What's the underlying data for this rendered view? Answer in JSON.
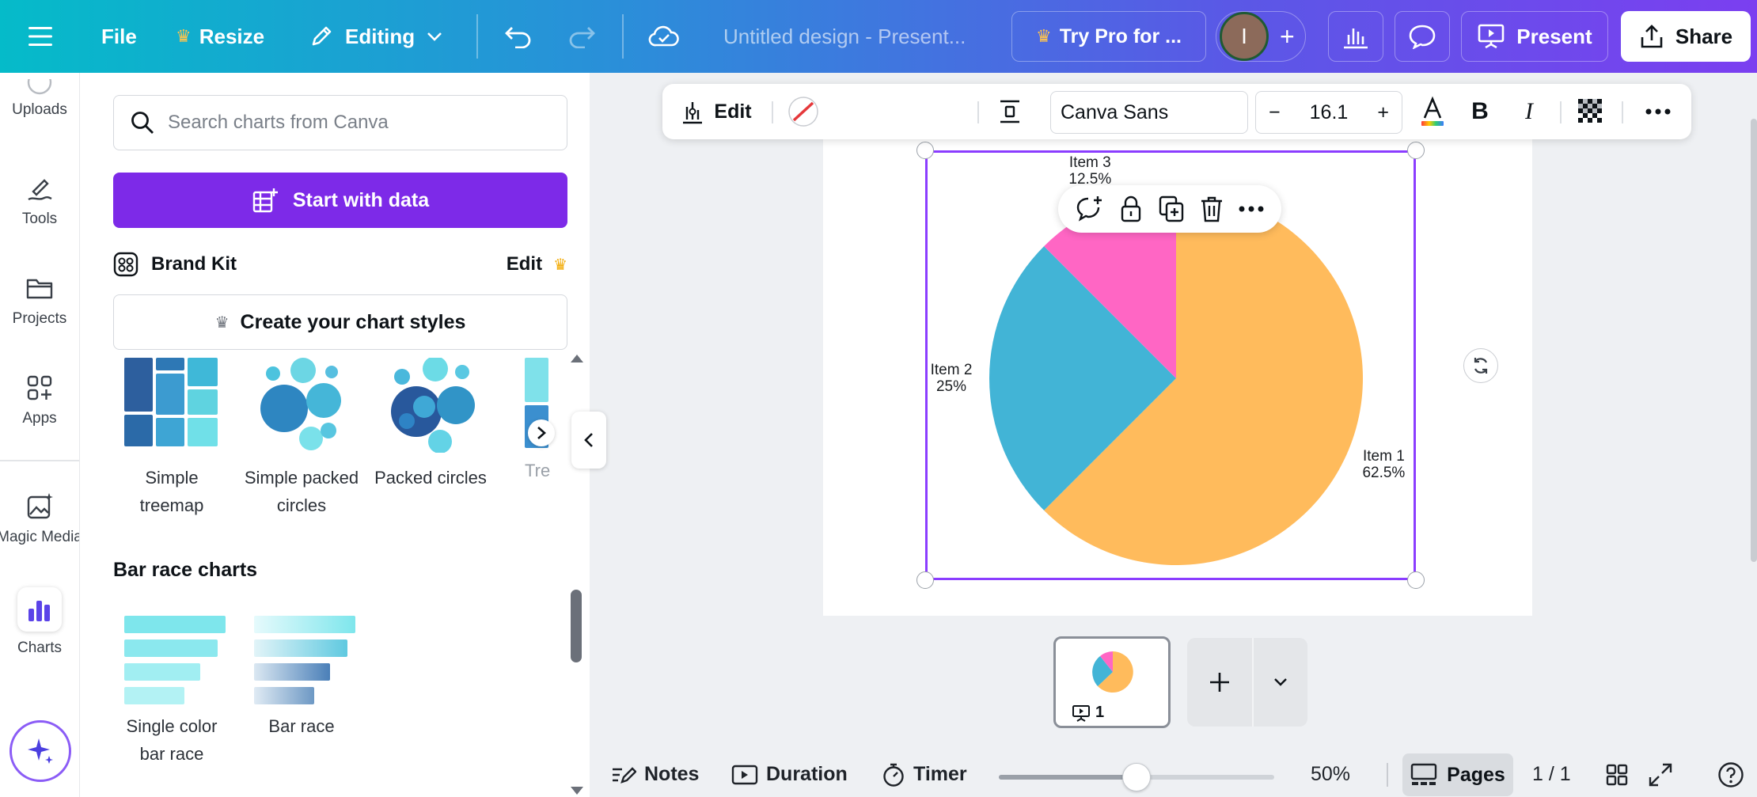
{
  "topbar": {
    "file_label": "File",
    "resize_label": "Resize",
    "editing_label": "Editing",
    "doc_title": "Untitled design - Present...",
    "try_pro_label": "Try Pro for ...",
    "avatar_initial": "I",
    "present_label": "Present",
    "share_label": "Share"
  },
  "rail": {
    "items": [
      {
        "label": "Uploads",
        "icon": "uploads-icon"
      },
      {
        "label": "Tools",
        "icon": "tools-icon"
      },
      {
        "label": "Projects",
        "icon": "folder-icon"
      },
      {
        "label": "Apps",
        "icon": "apps-icon"
      },
      {
        "label": "Magic Media",
        "icon": "magic-media-icon"
      },
      {
        "label": "Charts",
        "icon": "charts-icon"
      }
    ]
  },
  "panel": {
    "search_placeholder": "Search charts from Canva",
    "start_with_data": "Start with data",
    "brand_kit": "Brand Kit",
    "brand_kit_edit": "Edit",
    "create_styles": "Create your chart styles",
    "tiles": [
      {
        "label": "Simple treemap"
      },
      {
        "label": "Simple packed circles"
      },
      {
        "label": "Packed circles"
      },
      {
        "label": "Tre"
      }
    ],
    "bar_race_title": "Bar race charts",
    "bar_race_tiles": [
      {
        "label": "Single color bar race"
      },
      {
        "label": "Bar race"
      }
    ]
  },
  "context_toolbar": {
    "edit_label": "Edit",
    "font_name": "Canva Sans",
    "font_size": "16.1",
    "minus": "−",
    "plus": "+",
    "bold": "B",
    "italic": "I",
    "swatch_colors": [
      "#ffb74d",
      "#42b4d6",
      "#ff66c4"
    ]
  },
  "chart_data": {
    "type": "pie",
    "categories": [
      "Item 1",
      "Item 2",
      "Item 3"
    ],
    "values": [
      62.5,
      25,
      12.5
    ],
    "value_labels": [
      "62.5%",
      "25%",
      "12.5%"
    ],
    "colors": [
      "#ffbb5c",
      "#42b4d6",
      "#ff66c4"
    ]
  },
  "thumbnail": {
    "page_number": "1"
  },
  "bottombar": {
    "notes": "Notes",
    "duration": "Duration",
    "timer": "Timer",
    "zoom_value": 50,
    "zoom_label": "50%",
    "pages": "Pages",
    "page_count": "1 / 1"
  }
}
